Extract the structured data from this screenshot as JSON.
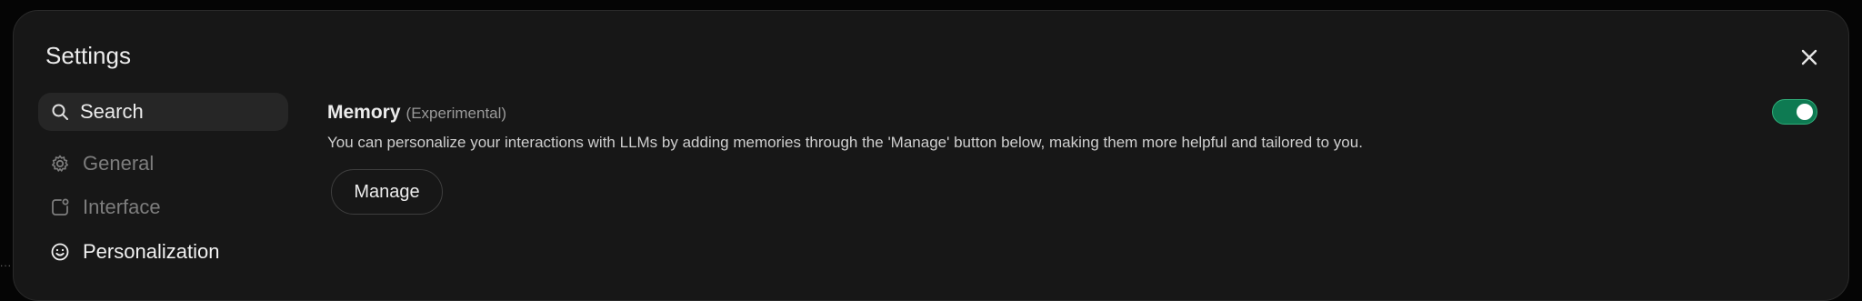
{
  "modal": {
    "title": "Settings"
  },
  "sidebar": {
    "search_label": "Search",
    "items": [
      {
        "label": "General",
        "icon": "gear-icon",
        "active": false
      },
      {
        "label": "Interface",
        "icon": "interface-icon",
        "active": false
      },
      {
        "label": "Personalization",
        "icon": "smile-icon",
        "active": true
      }
    ]
  },
  "memory": {
    "title": "Memory",
    "tag": "(Experimental)",
    "description": "You can personalize your interactions with LLMs by adding memories through the 'Manage' button below, making them more helpful and tailored to you.",
    "manage_label": "Manage",
    "enabled": true
  },
  "colors": {
    "background": "#171717",
    "accent_toggle": "#0e7a52",
    "text_primary": "#ececec",
    "text_dim": "#7d7d7d"
  }
}
